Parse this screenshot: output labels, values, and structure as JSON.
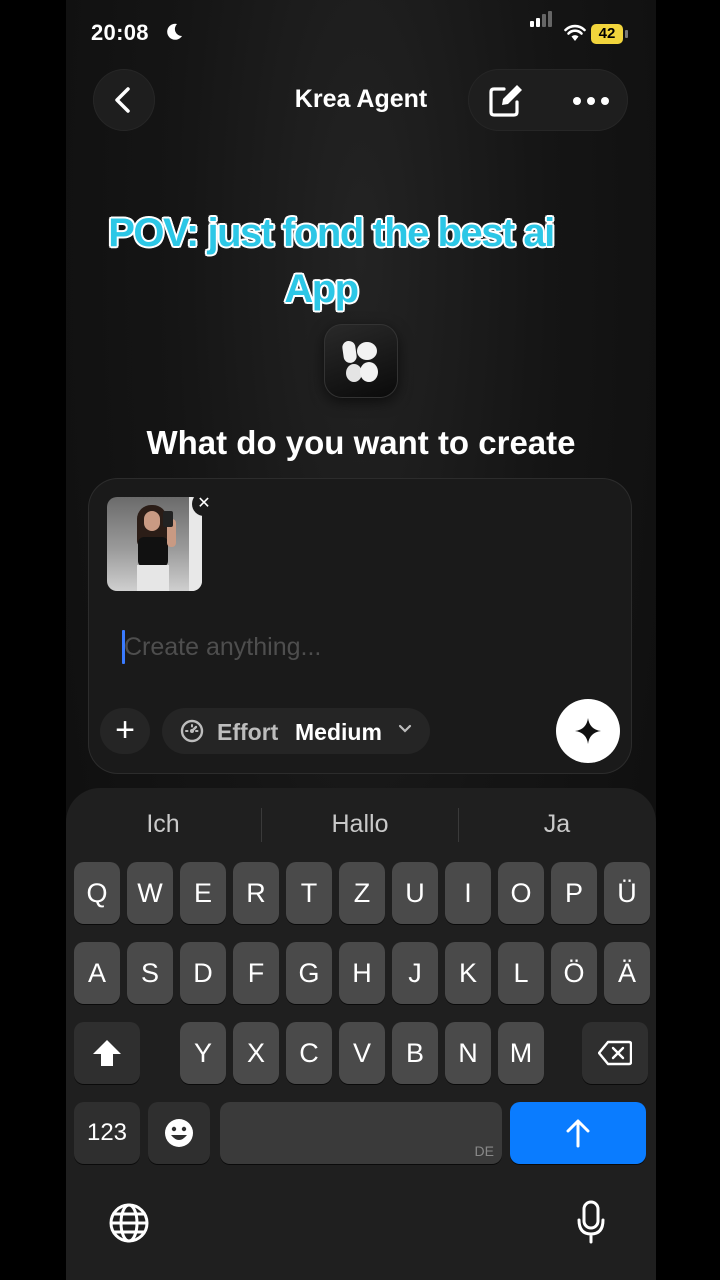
{
  "status_bar": {
    "time": "20:08",
    "battery": "42"
  },
  "header": {
    "title": "Krea Agent"
  },
  "overlay_caption": {
    "line1": "POV: just fond the best ai",
    "line2": "App"
  },
  "main": {
    "headline": "What do you want to create",
    "prompt": {
      "value": "",
      "placeholder": "Create anything..."
    },
    "effort": {
      "label": "Effort",
      "value": "Medium"
    }
  },
  "keyboard": {
    "suggestions": [
      "Ich",
      "Hallo",
      "Ja"
    ],
    "row1": [
      "Q",
      "W",
      "E",
      "R",
      "T",
      "Z",
      "U",
      "I",
      "O",
      "P",
      "Ü"
    ],
    "row2": [
      "A",
      "S",
      "D",
      "F",
      "G",
      "H",
      "J",
      "K",
      "L",
      "Ö",
      "Ä"
    ],
    "row3": [
      "Y",
      "X",
      "C",
      "V",
      "B",
      "N",
      "M"
    ],
    "numbers_key": "123",
    "space_language": "DE"
  },
  "icons": {
    "back": "chevron-left-icon",
    "edit": "compose-icon",
    "more": "ellipsis-icon",
    "effort": "gauge-icon",
    "send": "sparkle-icon",
    "shift": "shift-icon",
    "delete": "backspace-icon",
    "emoji": "emoji-icon",
    "return": "arrow-up-icon",
    "globe": "globe-icon",
    "mic": "microphone-icon"
  },
  "colors": {
    "caption": "#2cc7e6",
    "send_key": "#0a7cff",
    "battery": "#f2d53c",
    "caret": "#3a7bff"
  }
}
